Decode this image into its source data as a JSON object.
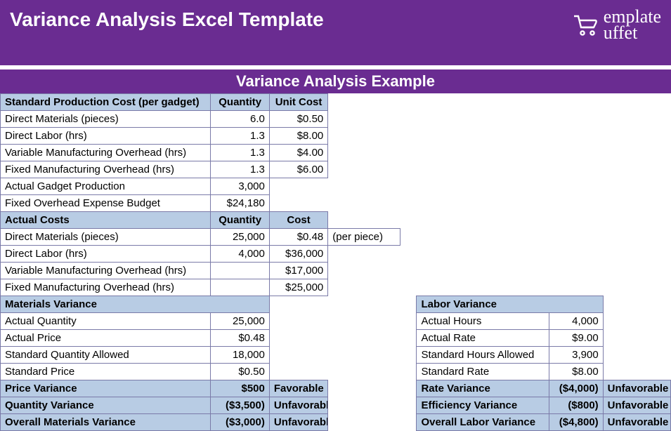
{
  "banner": {
    "title": "Variance Analysis Excel Template",
    "logo_line1": "emplate",
    "logo_line2": "uffet"
  },
  "example_title": "Variance Analysis Example",
  "std_cost": {
    "header_label": "Standard Production Cost (per gadget)",
    "header_qty": "Quantity",
    "header_uc": "Unit Cost",
    "rows": [
      {
        "label": "Direct Materials (pieces)",
        "qty": "6.0",
        "uc": "$0.50"
      },
      {
        "label": "Direct Labor (hrs)",
        "qty": "1.3",
        "uc": "$8.00"
      },
      {
        "label": "Variable Manufacturing Overhead (hrs)",
        "qty": "1.3",
        "uc": "$4.00"
      },
      {
        "label": "Fixed Manufacturing Overhead (hrs)",
        "qty": "1.3",
        "uc": "$6.00"
      }
    ],
    "agp_label": "Actual Gadget Production",
    "agp_val": "3,000",
    "foe_label": "Fixed Overhead Expense Budget",
    "foe_val": "$24,180"
  },
  "actual": {
    "header_label": "Actual Costs",
    "header_qty": "Quantity",
    "header_cost": "Cost",
    "rows": [
      {
        "label": "Direct Materials (pieces)",
        "qty": "25,000",
        "cost": "$0.48",
        "note": "(per piece)"
      },
      {
        "label": "Direct Labor (hrs)",
        "qty": "4,000",
        "cost": "$36,000",
        "note": ""
      },
      {
        "label": "Variable Manufacturing Overhead (hrs)",
        "qty": "",
        "cost": "$17,000",
        "note": ""
      },
      {
        "label": "Fixed Manufacturing Overhead (hrs)",
        "qty": "",
        "cost": "$25,000",
        "note": ""
      }
    ]
  },
  "mat": {
    "header": "Materials Variance",
    "actual_qty_label": "Actual Quantity",
    "actual_qty": "25,000",
    "actual_price_label": "Actual Price",
    "actual_price": "$0.48",
    "std_qty_label": "Standard Quantity Allowed",
    "std_qty": "18,000",
    "std_price_label": "Standard Price",
    "std_price": "$0.50",
    "price_var_label": "Price Variance",
    "price_var": "$500",
    "price_var_note": "Favorable",
    "qty_var_label": "Quantity Variance",
    "qty_var": "($3,500)",
    "qty_var_note": "Unfavorable",
    "overall_label": "Overall Materials Variance",
    "overall": "($3,000)",
    "overall_note": "Unfavorable"
  },
  "lab": {
    "header": "Labor Variance",
    "actual_hrs_label": "Actual Hours",
    "actual_hrs": "4,000",
    "actual_rate_label": "Actual Rate",
    "actual_rate": "$9.00",
    "std_hrs_label": "Standard Hours Allowed",
    "std_hrs": "3,900",
    "std_rate_label": "Standard Rate",
    "std_rate": "$8.00",
    "rate_var_label": "Rate Variance",
    "rate_var": "($4,000)",
    "rate_var_note": "Unfavorable",
    "eff_var_label": "Efficiency Variance",
    "eff_var": "($800)",
    "eff_var_note": "Unfavorable",
    "overall_label": "Overall Labor Variance",
    "overall": "($4,800)",
    "overall_note": "Unfavorable"
  }
}
